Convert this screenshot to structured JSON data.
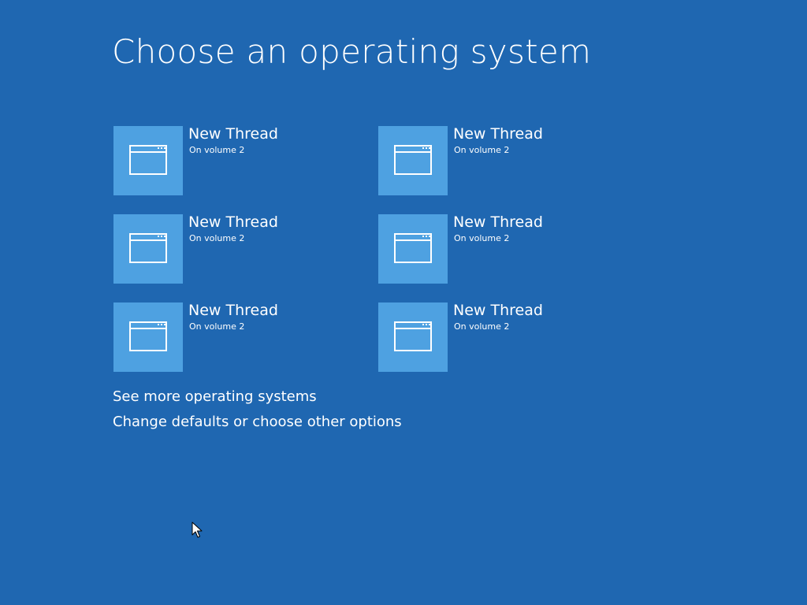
{
  "screen": {
    "title": "Choose an operating system"
  },
  "entries": [
    {
      "name": "New Thread",
      "volume": "On volume 2"
    },
    {
      "name": "New Thread",
      "volume": "On volume 2"
    },
    {
      "name": "New Thread",
      "volume": "On volume 2"
    },
    {
      "name": "New Thread",
      "volume": "On volume 2"
    },
    {
      "name": "New Thread",
      "volume": "On volume 2"
    },
    {
      "name": "New Thread",
      "volume": "On volume 2"
    }
  ],
  "links": {
    "more": "See more operating systems",
    "change": "Change defaults or choose other options"
  },
  "colors": {
    "background": "#1f67b1",
    "tile": "#4ea1e1",
    "text": "#ffffff"
  },
  "icons": {
    "os_entry": "window-icon",
    "pointer": "mouse-pointer-icon"
  }
}
